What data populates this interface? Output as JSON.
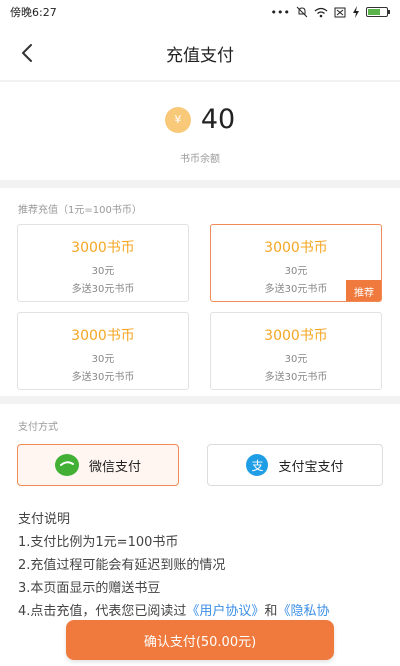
{
  "status_bar": {
    "time": "傍晚6:27",
    "icons": [
      "more-icon",
      "mute-icon",
      "wifi-icon",
      "sim-icon",
      "charging-icon",
      "battery-icon"
    ]
  },
  "nav": {
    "title": "充值支付",
    "back_icon": "chevron-left-icon"
  },
  "balance": {
    "value": "40",
    "label": "书币余额",
    "coin_symbol": "¥"
  },
  "recharge": {
    "section_label": "推荐充值（1元=100书币）",
    "packages": [
      {
        "coins": "3000书币",
        "price": "30元",
        "bonus": "多送30元书币",
        "selected": false,
        "badge": ""
      },
      {
        "coins": "3000书币",
        "price": "30元",
        "bonus": "多送30元书币",
        "selected": true,
        "badge": "推荐"
      },
      {
        "coins": "3000书币",
        "price": "30元",
        "bonus": "多送30元书币",
        "selected": false,
        "badge": ""
      },
      {
        "coins": "3000书币",
        "price": "30元",
        "bonus": "多送30元书币",
        "selected": false,
        "badge": ""
      }
    ]
  },
  "payment": {
    "section_label": "支付方式",
    "methods": [
      {
        "label": "微信支付",
        "icon": "wechat-icon",
        "selected": true
      },
      {
        "label": "支付宝支付",
        "icon": "alipay-icon",
        "selected": false,
        "icon_glyph": "支"
      }
    ]
  },
  "notes": {
    "title": "支付说明",
    "lines": [
      "1.支付比例为1元=100书币",
      "2.充值过程可能会有延迟到账的情况",
      "3.本页面显示的赠送书豆"
    ],
    "line4_prefix": "4.点击充值，代表您已阅读过",
    "link1": "《用户协议》",
    "and": "和",
    "link2": "《隐私协"
  },
  "confirm": {
    "label": "确认支付(50.00元)"
  },
  "colors": {
    "accent": "#f07a3e",
    "coin": "#f5a623",
    "wechat": "#41b035",
    "alipay": "#1f9ee5",
    "link": "#3a8ee6"
  }
}
